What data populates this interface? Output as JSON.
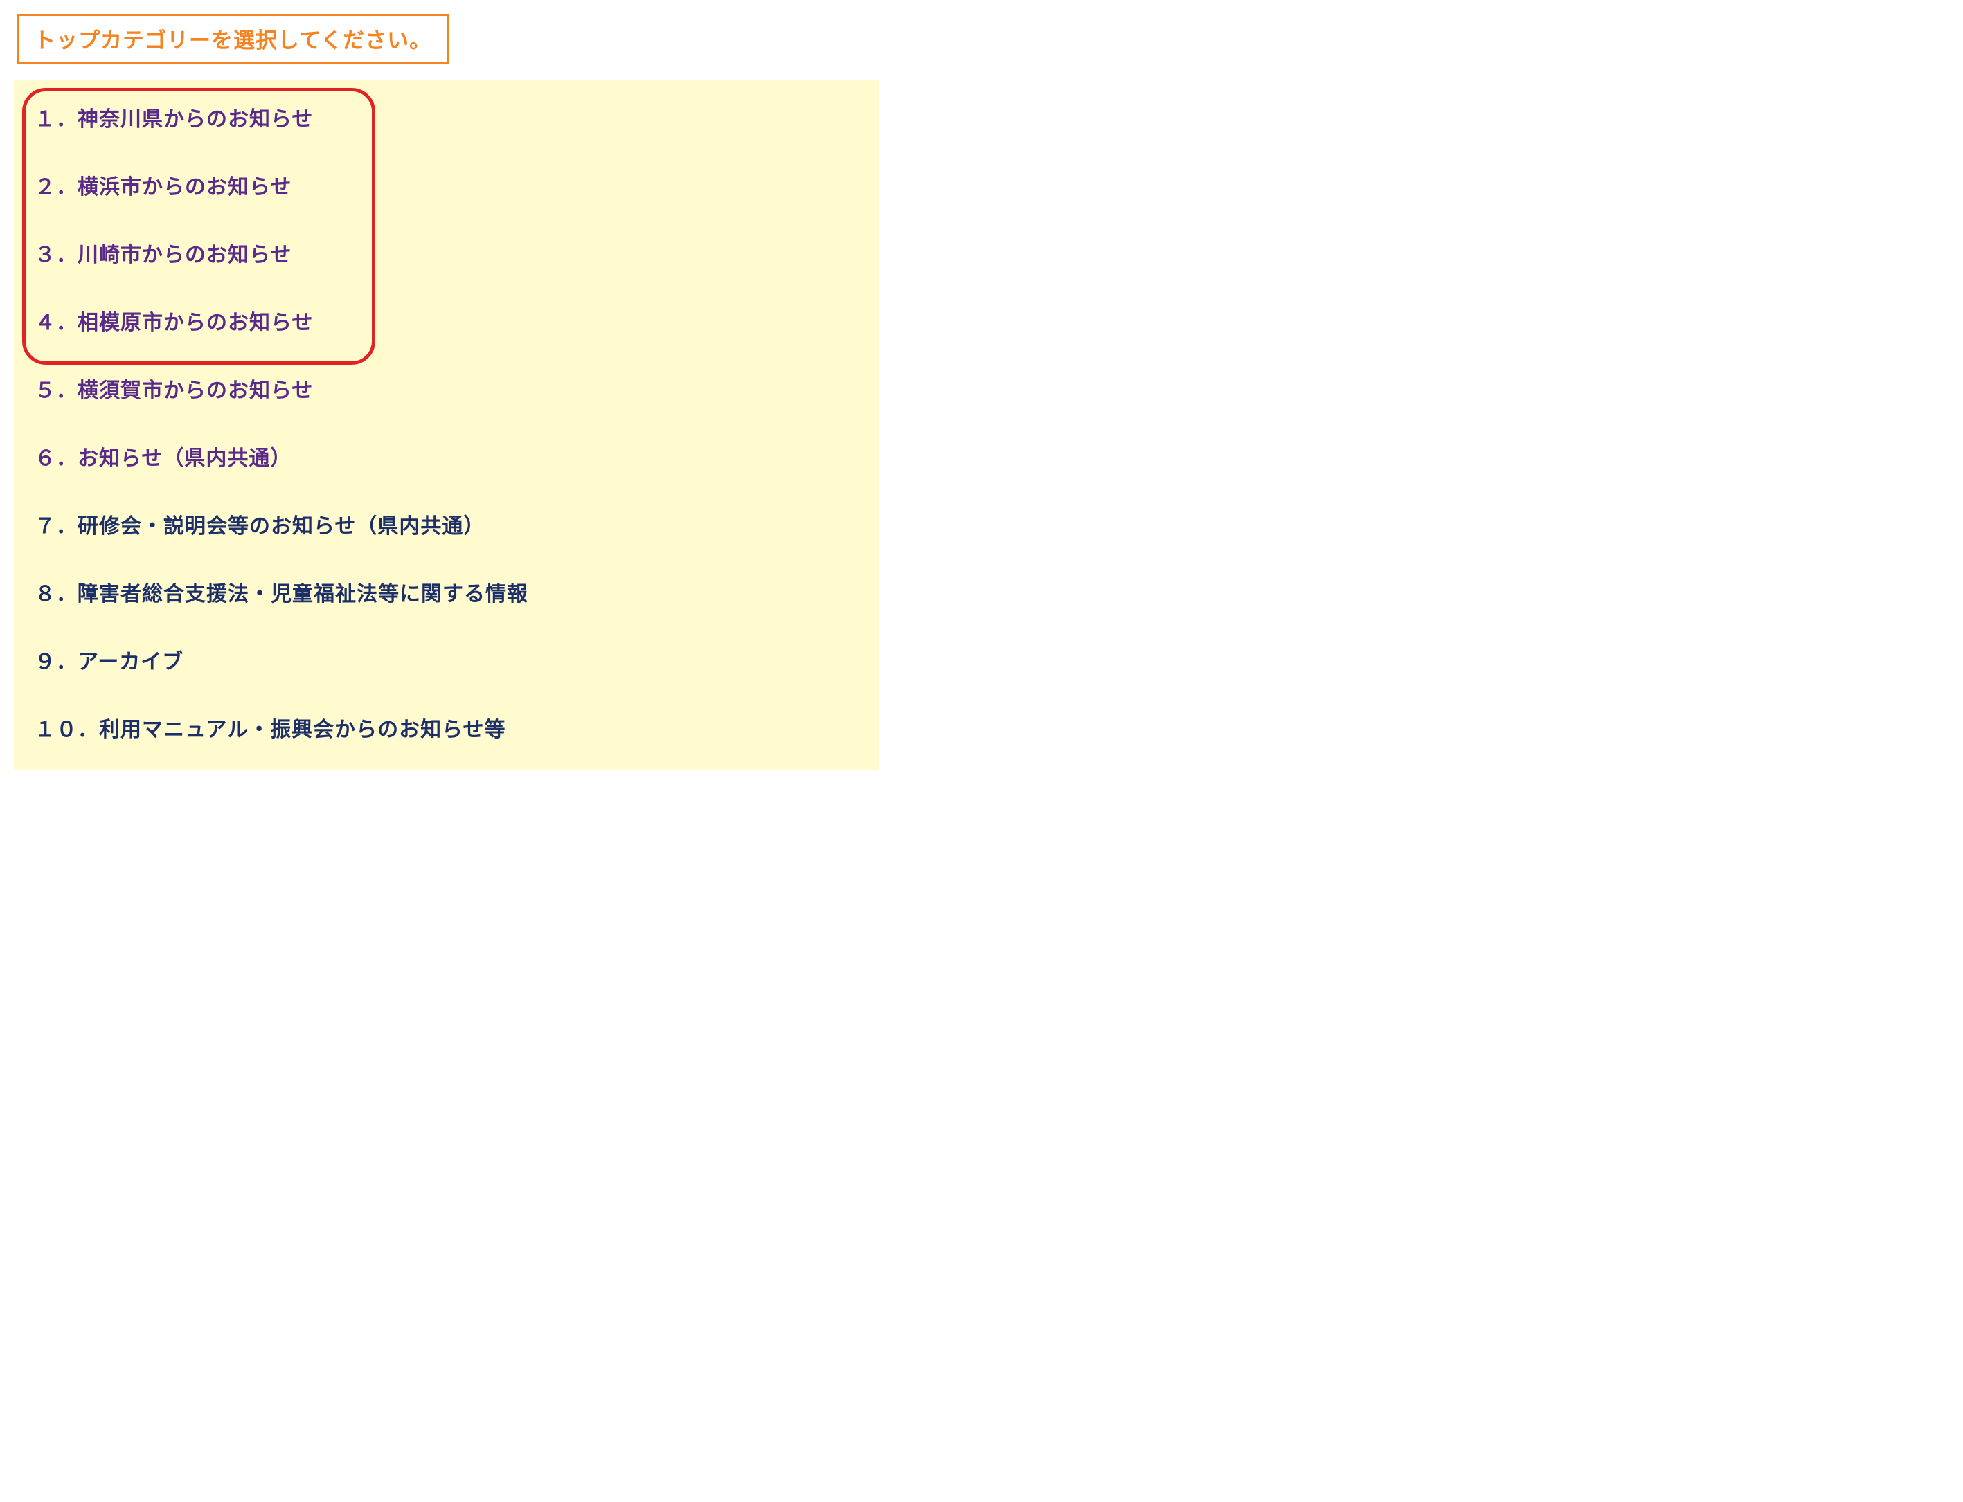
{
  "header": {
    "title": "トップカテゴリーを選択してください。"
  },
  "categories": [
    {
      "number": "１．",
      "label": "神奈川県からのお知らせ",
      "visited": true,
      "highlighted": true
    },
    {
      "number": "２．",
      "label": "横浜市からのお知らせ",
      "visited": true,
      "highlighted": true
    },
    {
      "number": "３．",
      "label": "川崎市からのお知らせ",
      "visited": true,
      "highlighted": true
    },
    {
      "number": "４．",
      "label": "相模原市からのお知らせ",
      "visited": true,
      "highlighted": true
    },
    {
      "number": "５．",
      "label": "横須賀市からのお知らせ",
      "visited": true,
      "highlighted": true
    },
    {
      "number": "６．",
      "label": "お知らせ（県内共通）",
      "visited": true,
      "highlighted": false
    },
    {
      "number": "７．",
      "label": "研修会・説明会等のお知らせ（県内共通）",
      "visited": false,
      "highlighted": false
    },
    {
      "number": "８．",
      "label": "障害者総合支援法・児童福祉法等に関する情報",
      "visited": false,
      "highlighted": false
    },
    {
      "number": "９．",
      "label": "アーカイブ",
      "visited": false,
      "highlighted": false
    },
    {
      "number": "１０．",
      "label": "利用マニュアル・振興会からのお知らせ等",
      "visited": false,
      "highlighted": false
    }
  ],
  "colors": {
    "accent_orange": "#f58320",
    "highlight_red": "#e02424",
    "panel_bg": "#fffbcf",
    "link_visited": "#5a2a8a",
    "link_navy": "#1c2f68"
  }
}
